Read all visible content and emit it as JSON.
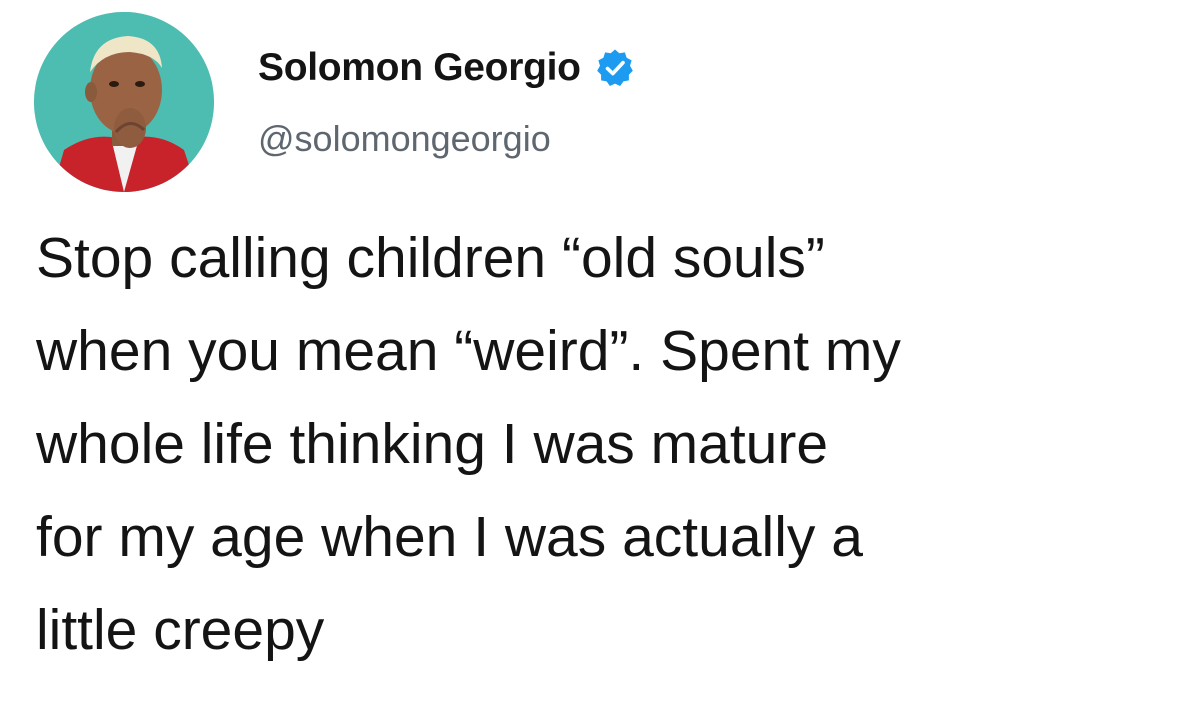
{
  "author": {
    "display_name": "Solomon Georgio",
    "handle": "@solomongeorgio",
    "verified_icon": "verified-badge-icon",
    "avatar_icon": "profile-photo"
  },
  "tweet": {
    "lines": [
      "Stop calling children “old souls”",
      "when you mean “weird”. Spent my",
      "whole life thinking I was mature",
      "for my age when I was actually a",
      "little creepy"
    ]
  },
  "colors": {
    "background": "#ffffff",
    "text": "#141414",
    "handle": "#5e6670",
    "verified": "#1d9bf0",
    "avatar_bg": "#4dbdb1"
  }
}
